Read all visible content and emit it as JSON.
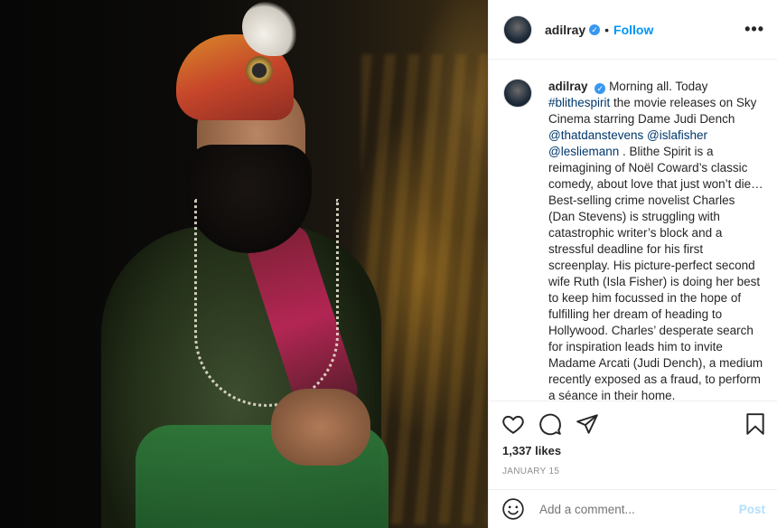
{
  "post": {
    "username": "adilray",
    "follow_label": "Follow",
    "separator": "•",
    "more_label": "•••"
  },
  "caption": {
    "username": "adilray",
    "segments": [
      {
        "text": "Morning all. Today ",
        "type": "text"
      },
      {
        "text": "#blithespirit",
        "type": "tag"
      },
      {
        "text": " the movie releases on Sky Cinema starring Dame Judi Dench ",
        "type": "text"
      },
      {
        "text": "@thatdanstevens",
        "type": "tag"
      },
      {
        "text": " ",
        "type": "text"
      },
      {
        "text": "@islafisher",
        "type": "tag"
      },
      {
        "text": " ",
        "type": "text"
      },
      {
        "text": "@lesliemann",
        "type": "tag"
      },
      {
        "text": " . Blithe Spirit is a reimagining of Noël Coward’s classic comedy, about love that just won’t die… Best-selling crime novelist Charles (Dan Stevens) is struggling with catastrophic writer’s block and a stressful deadline for his first screenplay. His picture-perfect second wife Ruth (Isla Fisher) is doing her best to keep him focussed in the hope of fulfilling her dream of heading to Hollywood. Charles’ desperate search for inspiration leads him to invite Madame Arcati (Judi Dench), a medium recently exposed as a fraud, to perform a séance in their home.",
        "type": "text"
      }
    ]
  },
  "engagement": {
    "likes": "1,337 likes",
    "date": "JANUARY 15"
  },
  "comment": {
    "placeholder": "Add a comment...",
    "post_label": "Post"
  },
  "colors": {
    "accent": "#0095f6",
    "verified": "#3897f0",
    "tag": "#00376b",
    "post_disabled": "#b2dffc"
  },
  "icons": [
    "verified-badge-icon",
    "heart-icon",
    "comment-icon",
    "share-icon",
    "bookmark-icon",
    "emoji-icon"
  ]
}
